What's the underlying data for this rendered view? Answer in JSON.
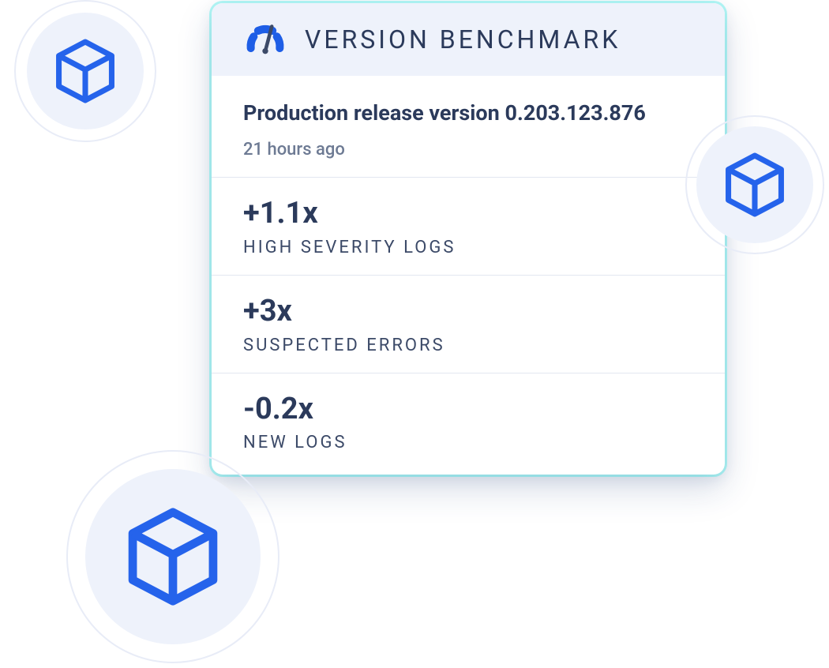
{
  "card": {
    "title": "VERSION BENCHMARK",
    "release": {
      "name": "Production release version 0.203.123.876",
      "time": "21 hours ago"
    },
    "metrics": [
      {
        "value": "+1.1x",
        "label": "HIGH SEVERITY LOGS"
      },
      {
        "value": "+3x",
        "label": "SUSPECTED ERRORS"
      },
      {
        "value": "-0.2x",
        "label": "NEW LOGS"
      }
    ]
  },
  "colors": {
    "cube": "#2563eb",
    "gauge_primary": "#1e5ee6",
    "gauge_needle": "#3c4a68",
    "accent_glow": "#26e9e2"
  }
}
